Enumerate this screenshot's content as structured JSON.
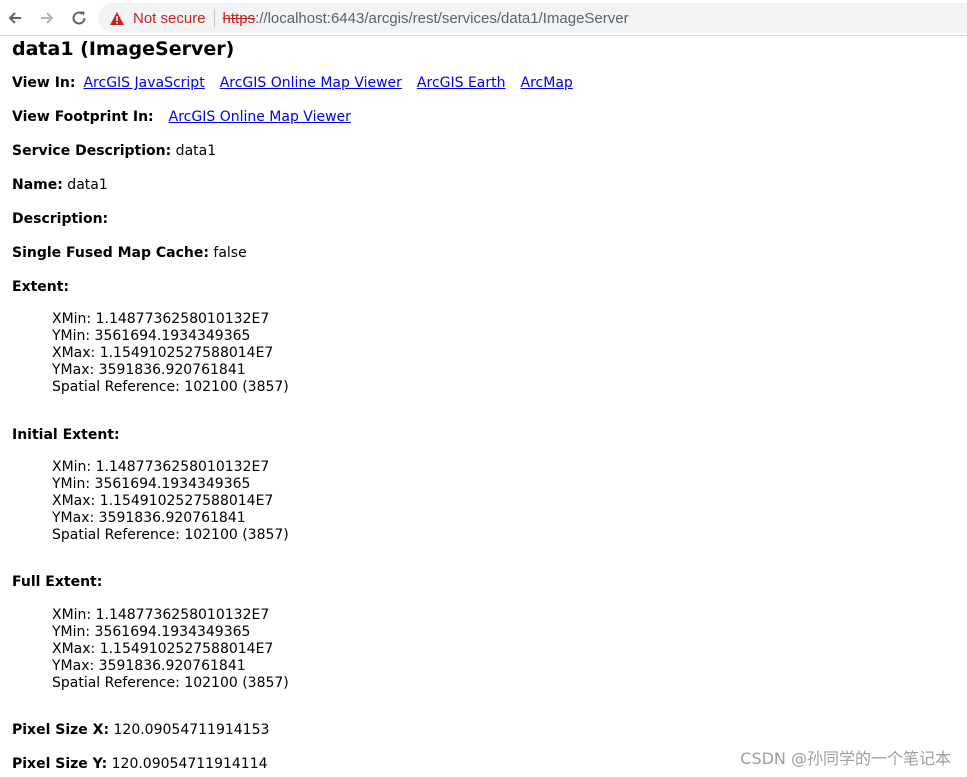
{
  "browser": {
    "not_secure": "Not secure",
    "url_scheme": "https",
    "url_rest": "://localhost:6443/arcgis/rest/services/data1/ImageServer",
    "icons": [
      "back-arrow-icon",
      "forward-arrow-icon",
      "reload-icon",
      "warning-icon"
    ]
  },
  "page": {
    "title": "data1 (ImageServer)",
    "view_in_label": "View In:",
    "view_in_links": [
      "ArcGIS JavaScript",
      "ArcGIS Online Map Viewer",
      "ArcGIS Earth",
      "ArcMap"
    ],
    "view_footprint_label": "View Footprint In:",
    "view_footprint_link": "ArcGIS Online Map Viewer",
    "service_description_label": "Service Description:",
    "service_description_value": " data1",
    "name_label": "Name:",
    "name_value": " data1",
    "description_label": "Description:",
    "single_fused_label": "Single Fused Map Cache:",
    "single_fused_value": " false",
    "extent_label": "Extent:",
    "initial_extent_label": "Initial Extent:",
    "full_extent_label": "Full Extent:",
    "extent_lines": [
      "XMin: 1.1487736258010132E7",
      "YMin: 3561694.1934349365",
      "XMax: 1.1549102527588014E7",
      "YMax: 3591836.920761841",
      "Spatial Reference: 102100  (3857)"
    ],
    "pixel_size_x_label": "Pixel Size X:",
    "pixel_size_x_value": " 120.09054711914153",
    "pixel_size_y_label": "Pixel Size Y:",
    "pixel_size_y_value": " 120.09054711914114"
  },
  "watermark": "CSDN @孙同学的一个笔记本",
  "colors": {
    "link": "#0000ee",
    "warning": "#c5221f"
  }
}
